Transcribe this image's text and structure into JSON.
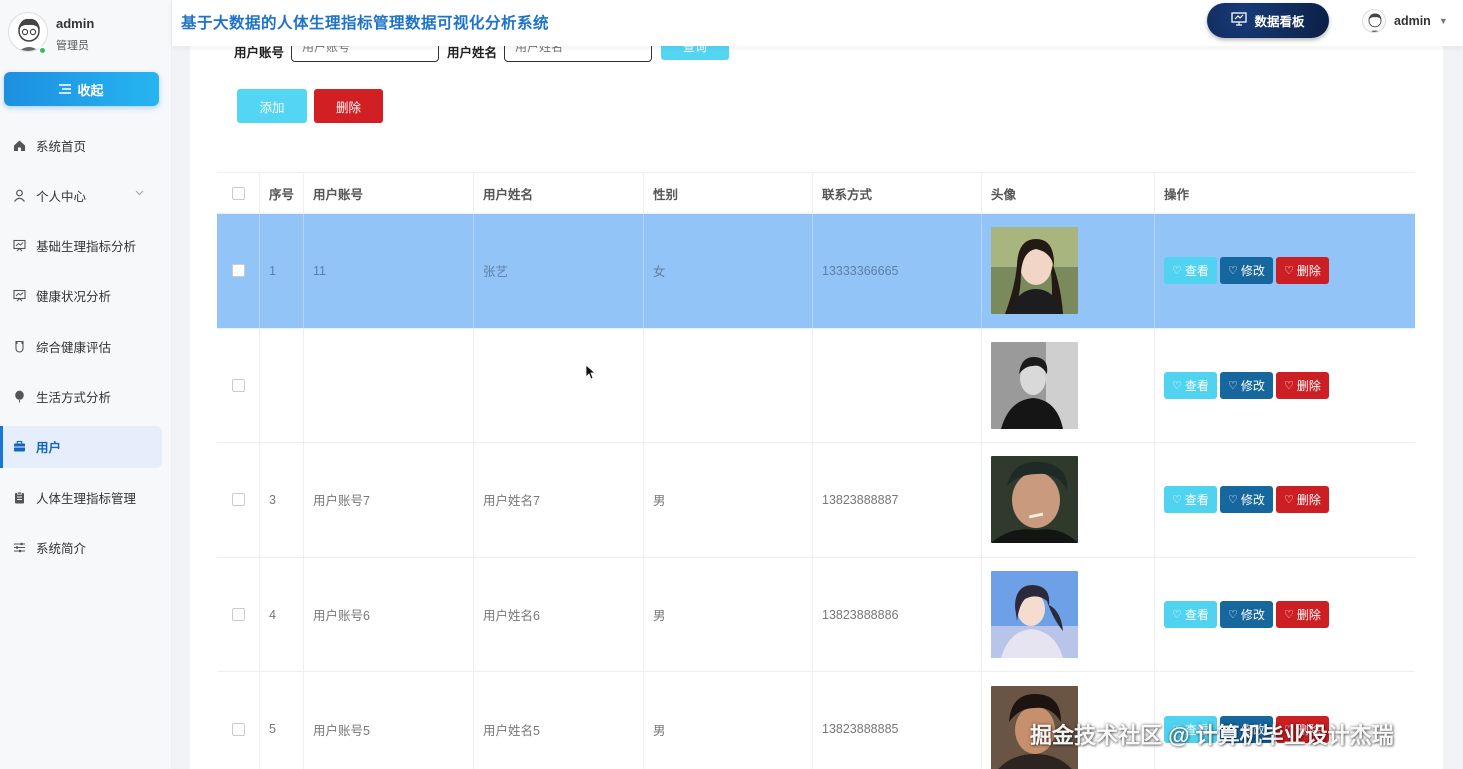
{
  "app": {
    "title": "基于大数据的人体生理指标管理数据可视化分析系统"
  },
  "header": {
    "dashboard_label": "数据看板",
    "user_name": "admin"
  },
  "sidebar": {
    "profile": {
      "name": "admin",
      "role": "管理员"
    },
    "collapse_label": "收起",
    "items": [
      {
        "label": "系统首页",
        "icon": "home-icon"
      },
      {
        "label": "个人中心",
        "icon": "person-icon"
      },
      {
        "label": "基础生理指标分析",
        "icon": "chart-board-icon"
      },
      {
        "label": "健康状况分析",
        "icon": "chart-board-icon"
      },
      {
        "label": "综合健康评估",
        "icon": "cup-icon"
      },
      {
        "label": "生活方式分析",
        "icon": "balloon-icon"
      },
      {
        "label": "用户",
        "icon": "briefcase-icon"
      },
      {
        "label": "人体生理指标管理",
        "icon": "clipboard-icon"
      },
      {
        "label": "系统简介",
        "icon": "sliders-icon"
      }
    ],
    "active_index": 6
  },
  "search": {
    "account_label": "用户账号",
    "account_placeholder": "用户账号",
    "name_label": "用户姓名",
    "name_placeholder": "用户姓名",
    "query_label": "查询"
  },
  "toolbar": {
    "add_label": "添加",
    "delete_label": "删除"
  },
  "table": {
    "columns": [
      "序号",
      "用户账号",
      "用户姓名",
      "性别",
      "联系方式",
      "头像",
      "操作"
    ],
    "actions": {
      "view": "查看",
      "edit": "修改",
      "remove": "删除"
    },
    "rows": [
      {
        "index": "1",
        "account": "11",
        "name": "张艺",
        "gender": "女",
        "phone": "13333366665",
        "selected": true
      },
      {
        "index": "",
        "account": "",
        "name": "",
        "gender": "",
        "phone": "",
        "selected": false
      },
      {
        "index": "3",
        "account": "用户账号7",
        "name": "用户姓名7",
        "gender": "男",
        "phone": "13823888887",
        "selected": false
      },
      {
        "index": "4",
        "account": "用户账号6",
        "name": "用户姓名6",
        "gender": "男",
        "phone": "13823888886",
        "selected": false
      },
      {
        "index": "5",
        "account": "用户账号5",
        "name": "用户姓名5",
        "gender": "男",
        "phone": "13823888885",
        "selected": false
      }
    ]
  },
  "watermark": "掘金技术社区 @ 计算机毕业设计杰瑞",
  "colors": {
    "primary": "#1e73c8",
    "cyan": "#52d6f4",
    "danger": "#d21f24",
    "selected_row": "#93c4f7",
    "edit": "#17679f"
  }
}
